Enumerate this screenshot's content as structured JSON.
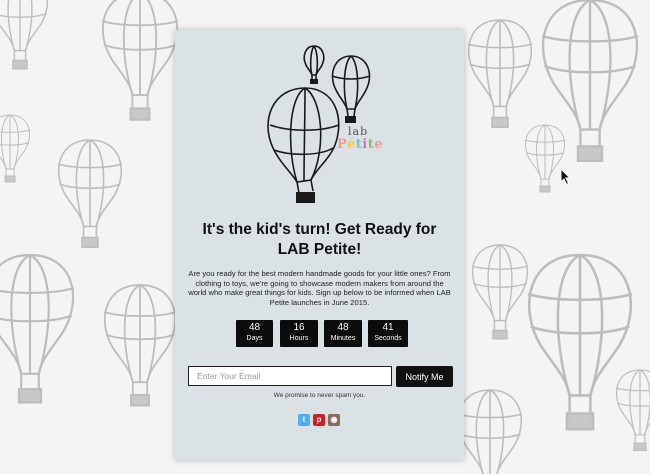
{
  "brand": {
    "logo_line1": "lab",
    "logo_line2": "Pétite",
    "logo_colors": [
      "#f39a8e",
      "#f2c94c",
      "#6cc5d6",
      "#c77dba",
      "#8dc063"
    ]
  },
  "headline": "It's the kid's turn! Get Ready for LAB Petite!",
  "description": "Are you ready for the best modern handmade goods for your little ones? From clothing to toys, we're going to showcase modern makers from around the world who make great things for kids. Sign up below to be informed when LAB Petite launches in June 2015.",
  "countdown": [
    {
      "value": "48",
      "label": "Days"
    },
    {
      "value": "16",
      "label": "Hours"
    },
    {
      "value": "48",
      "label": "Minutes"
    },
    {
      "value": "41",
      "label": "Seconds"
    }
  ],
  "signup": {
    "email_placeholder": "Enter Your Email",
    "email_value": "",
    "button_label": "Notify Me",
    "note": "We promise to never spam you."
  },
  "social": [
    {
      "icon": "twitter-icon",
      "color": "#55acee",
      "glyph": "t"
    },
    {
      "icon": "pinterest-icon",
      "color": "#cb2027",
      "glyph": "p"
    },
    {
      "icon": "instagram-icon",
      "color": "#8a6b55",
      "glyph": "◉"
    }
  ]
}
